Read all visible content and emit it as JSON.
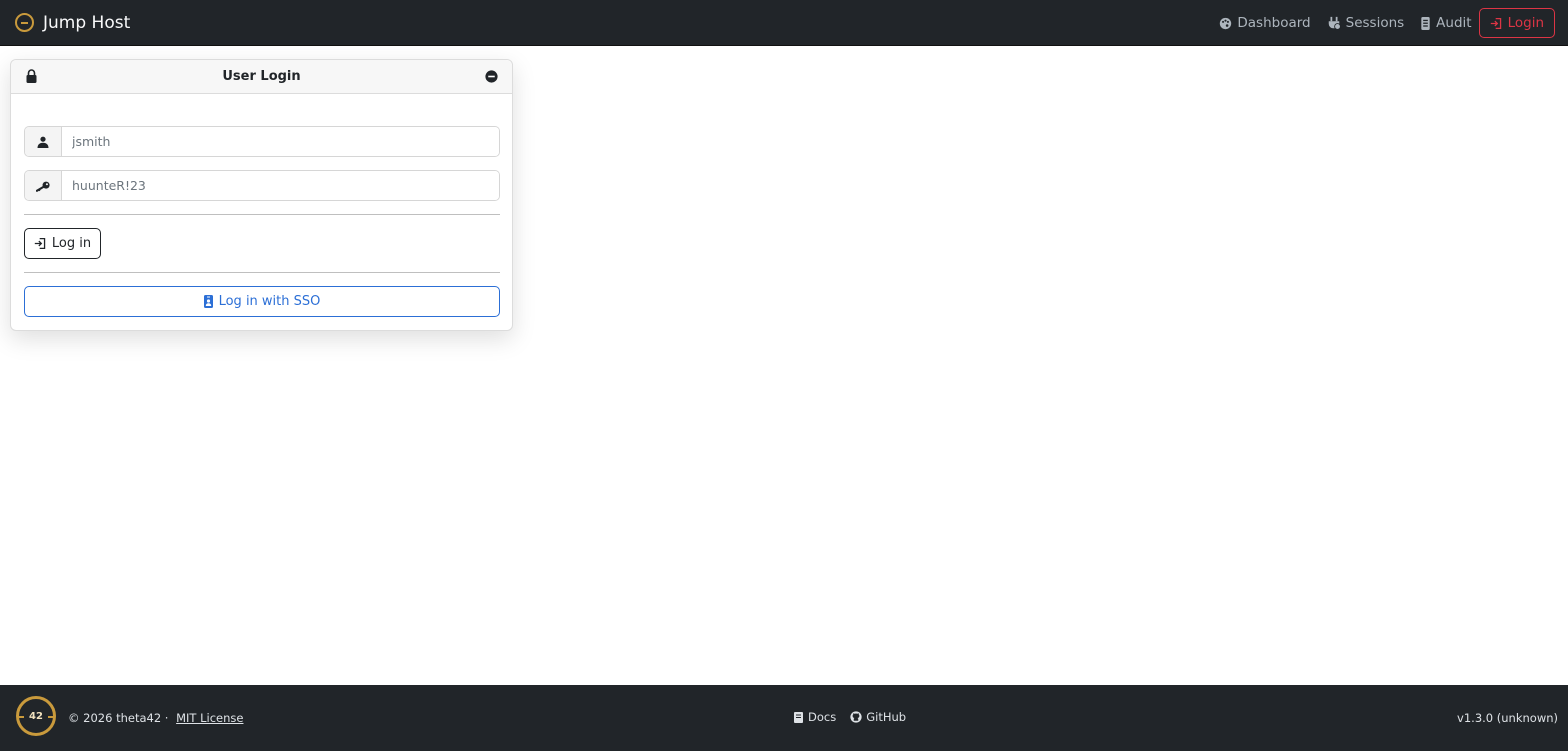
{
  "app": {
    "title": "Jump Host"
  },
  "nav": {
    "items": [
      {
        "label": "Dashboard",
        "icon": "palette-icon"
      },
      {
        "label": "Sessions",
        "icon": "plug-icon"
      },
      {
        "label": "Audit",
        "icon": "journal-icon"
      }
    ],
    "login_label": "Login"
  },
  "login_card": {
    "title": "User Login",
    "username": {
      "value": "jsmith",
      "icon": "person-icon"
    },
    "password": {
      "value": "huunteR!23",
      "icon": "key-icon"
    },
    "login_button": "Log in",
    "sso_button": "Log in with SSO"
  },
  "footer": {
    "logo_text": "42",
    "copyright": "© 2026 theta42 ·",
    "license": "MIT License",
    "links": [
      "Docs",
      "GitHub"
    ],
    "version": "v1.3.0 (unknown)"
  },
  "colors": {
    "topbar": "#212529",
    "danger": "#dc3545",
    "primary": "#2c6fd6",
    "logo_gold": "#c99a3c"
  }
}
